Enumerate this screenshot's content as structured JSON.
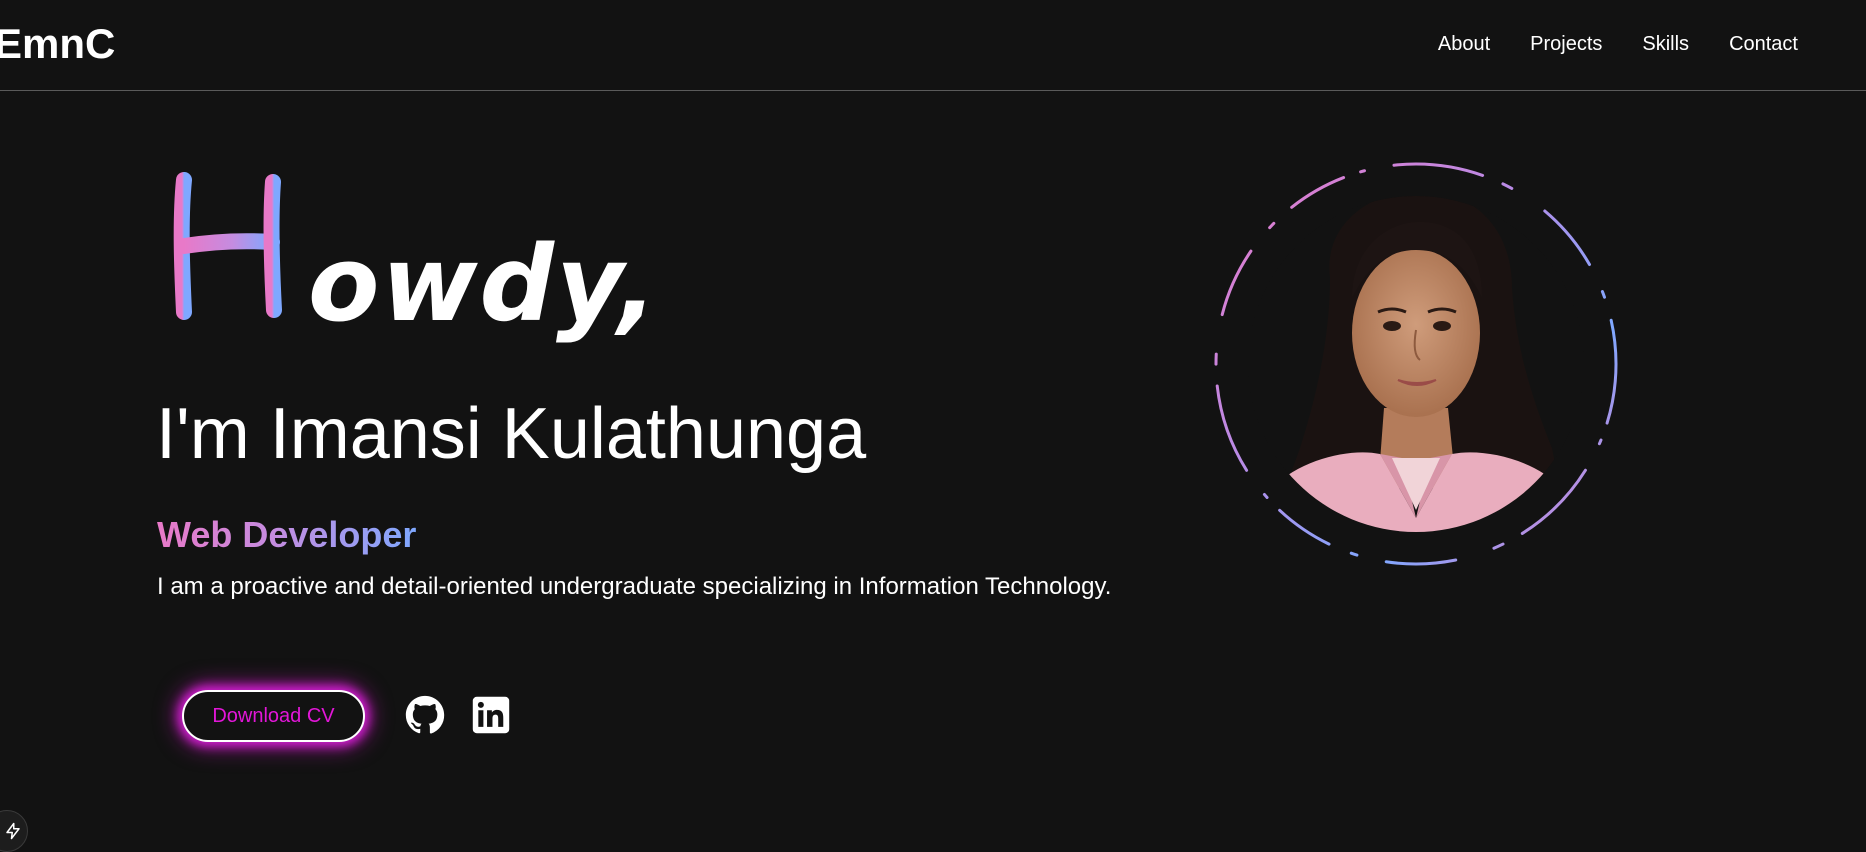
{
  "nav": {
    "logo": "EmnC",
    "links": [
      "About",
      "Projects",
      "Skills",
      "Contact"
    ]
  },
  "hero": {
    "greeting_first_letter": "H",
    "greeting_rest": "owdy,",
    "intro": "I'm Imansi Kulathunga",
    "role": "Web Developer",
    "summary": "I am a proactive and detail-oriented undergraduate specializing in Information Technology.",
    "cv_button": "Download CV"
  },
  "social": {
    "github_icon": "github-icon",
    "linkedin_icon": "linkedin-icon"
  },
  "portrait": {
    "subject": "profile-photo"
  },
  "colors": {
    "background": "#121212",
    "gradient_pink": "#e879c8",
    "gradient_blue": "#7fa8ff",
    "button_text": "#e216d8",
    "button_glow": "#d01ed0"
  }
}
